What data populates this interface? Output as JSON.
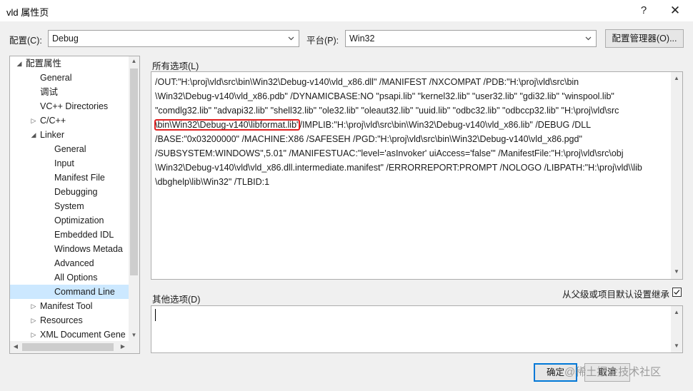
{
  "window": {
    "title": "vld 属性页",
    "help_glyph": "?",
    "close_glyph": "✕"
  },
  "config": {
    "label": "配置(C):",
    "value": "Debug"
  },
  "platform": {
    "label": "平台(P):",
    "value": "Win32"
  },
  "config_manager_button": "配置管理器(O)...",
  "tree": {
    "items": [
      {
        "label": "配置属性",
        "toggle": "◢"
      },
      {
        "label": "General"
      },
      {
        "label": "调试"
      },
      {
        "label": "VC++ Directories"
      },
      {
        "label": "C/C++",
        "toggle": "▷"
      },
      {
        "label": "Linker",
        "toggle": "◢"
      },
      {
        "label": "General"
      },
      {
        "label": "Input"
      },
      {
        "label": "Manifest File"
      },
      {
        "label": "Debugging"
      },
      {
        "label": "System"
      },
      {
        "label": "Optimization"
      },
      {
        "label": "Embedded IDL"
      },
      {
        "label": "Windows Metada"
      },
      {
        "label": "Advanced"
      },
      {
        "label": "All Options"
      },
      {
        "label": "Command Line",
        "selected": true
      },
      {
        "label": "Manifest Tool",
        "toggle": "▷"
      },
      {
        "label": "Resources",
        "toggle": "▷"
      },
      {
        "label": "XML Document Gene",
        "toggle": "▷"
      }
    ]
  },
  "all_options": {
    "label": "所有选项(L)",
    "lines": [
      "/OUT:\"H:\\proj\\vld\\src\\bin\\Win32\\Debug-v140\\vld_x86.dll\" /MANIFEST /NXCOMPAT /PDB:\"H:\\proj\\vld\\src\\bin",
      "\\Win32\\Debug-v140\\vld_x86.pdb\" /DYNAMICBASE:NO \"psapi.lib\" \"kernel32.lib\" \"user32.lib\" \"gdi32.lib\" \"winspool.lib\"",
      "\"comdlg32.lib\" \"advapi32.lib\" \"shell32.lib\" \"ole32.lib\" \"oleaut32.lib\" \"uuid.lib\" \"odbc32.lib\" \"odbccp32.lib\" \"H:\\proj\\vld\\src",
      "/IMPLIB:\"H:\\proj\\vld\\src\\bin\\Win32\\Debug-v140\\vld_x86.lib\" /DEBUG /DLL",
      "/BASE:\"0x03200000\" /MACHINE:X86 /SAFESEH /PGD:\"H:\\proj\\vld\\src\\bin\\Win32\\Debug-v140\\vld_x86.pgd\"",
      "/SUBSYSTEM:WINDOWS\",5.01\" /MANIFESTUAC:\"level='asInvoker' uiAccess='false'\" /ManifestFile:\"H:\\proj\\vld\\src\\obj",
      "\\Win32\\Debug-v140\\vld\\vld_x86.dll.intermediate.manifest\" /ERRORREPORT:PROMPT /NOLOGO /LIBPATH:\"H:\\proj\\vld\\\\lib",
      "\\dbghelp\\lib\\Win32\" /TLBID:1"
    ],
    "highlighted": "\\bin\\Win32\\Debug-v140\\libformat.lib\""
  },
  "other_options": {
    "label": "其他选项(D)",
    "value": "",
    "inherit_label": "从父级或项目默认设置继承",
    "inherit_checked": true
  },
  "buttons": {
    "ok": "确定",
    "cancel": "取消"
  },
  "watermark": "@稀土掘金技术社区",
  "colors": {
    "selection": "#cce8ff",
    "highlight_box": "#e02020",
    "default_button_border": "#0078d7"
  }
}
